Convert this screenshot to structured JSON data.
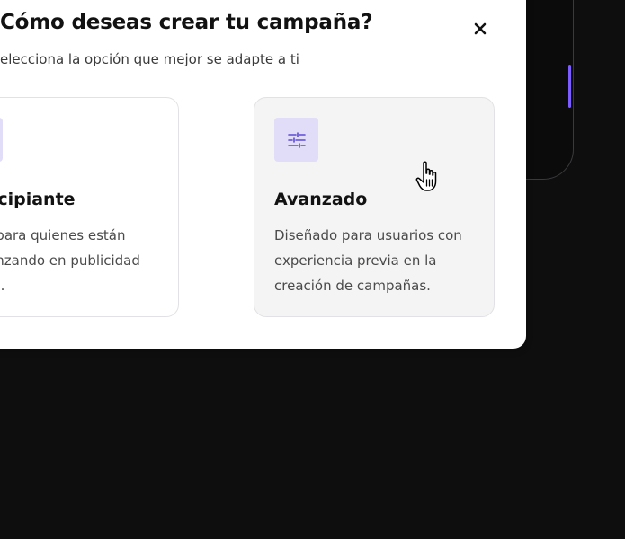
{
  "modal": {
    "title": "Cómo deseas crear tu campaña?",
    "subtitle": "elecciona la opción que mejor se adapte a ti",
    "close_icon": "close-icon"
  },
  "options": [
    {
      "title": "Principiante",
      "description": "Ideal para quienes están comenzando en publicidad digital.",
      "icon": "lightning-bolt-icon",
      "hovered": false
    },
    {
      "title": "Avanzado",
      "description": "Diseñado para usuarios con experiencia previa en la creación de campañas.",
      "icon": "sliders-icon",
      "hovered": true
    }
  ],
  "colors": {
    "accent": "#5b4bd6",
    "icon_bg": "#e1dcf8",
    "modal_bg": "#ffffff",
    "page_bg": "#0e0e0f",
    "hover_card_bg": "#f4f4f5"
  },
  "cursor": "hand-pointer-icon"
}
